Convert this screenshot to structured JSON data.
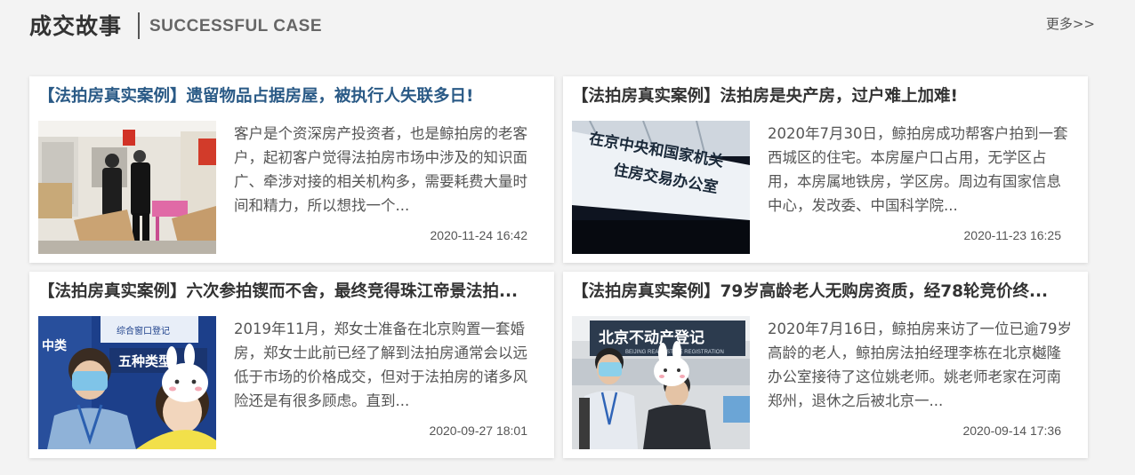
{
  "header": {
    "title_cn": "成交故事",
    "title_en": "SUCCESSFUL CASE",
    "more_label": "更多>>"
  },
  "cases": [
    {
      "title": "【法拍房真实案例】遗留物品占据房屋，被执行人失联多日!",
      "desc": "客户是个资深房产投资者，也是鲸拍房的老客户，起初客户觉得法拍房市场中涉及的知识面广、牵涉对接的相关机构多，需要耗费大量时间和精力，所以想找一个...",
      "date": "2020-11-24 16:42"
    },
    {
      "title": "【法拍房真实案例】法拍房是央产房，过户难上加难!",
      "desc": "2020年7月30日，鲸拍房成功帮客户拍到一套西城区的住宅。本房屋户口占用，无学区占用，本房属地铁房，学区房。周边有国家信息中心，发改委、中国科学院...",
      "date": "2020-11-23 16:25",
      "sign_text": "在京中央和国家机关住房交易办公室"
    },
    {
      "title": "【法拍房真实案例】六次参拍锲而不舍，最终竞得珠江帝景法拍...",
      "desc": "2019年11月，郑女士准备在北京购置一套婚房，郑女士此前已经了解到法拍房通常会以远低于市场的价格成交，但对于法拍房的诸多风险还是有很多顾虑。直到...",
      "date": "2020-09-27 18:01",
      "sign_text": "五种类型",
      "sign_text2": "综合窗口登记"
    },
    {
      "title": "【法拍房真实案例】79岁高龄老人无购房资质，经78轮竞价终...",
      "desc": "2020年7月16日，鲸拍房来访了一位已逾79岁高龄的老人，鲸拍房法拍经理李栋在北京樾隆办公室接待了这位姚老师。姚老师老家在河南郑州，退休之后被北京一...",
      "date": "2020-09-14 17:36",
      "sign_text": "北京不动产登记",
      "sign_text2": "BEIJING REAL ESTATE REGISTRATION"
    }
  ]
}
